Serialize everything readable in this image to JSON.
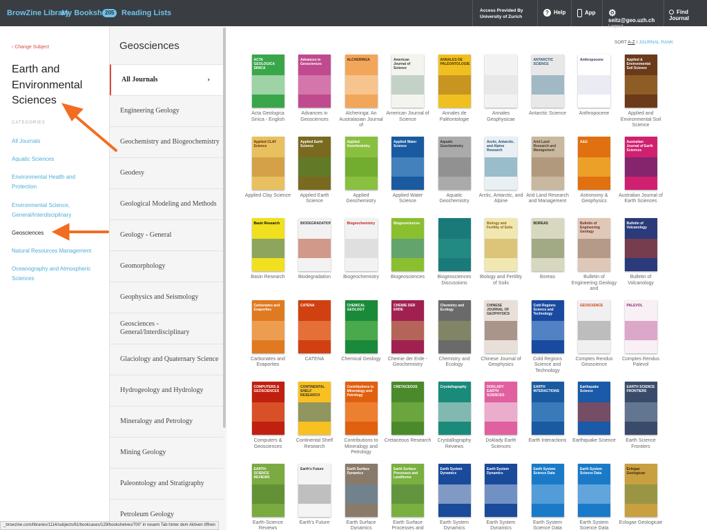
{
  "topbar": {
    "brand": "BrowZine Library",
    "bookshelf": "My Bookshelf",
    "bookshelf_count": "205",
    "reading_lists": "Reading Lists",
    "access_line1": "Access Provided By",
    "access_line2": "University of Zurich",
    "help": "Help",
    "app": "App",
    "user_email": "seitz@geo.uzh.ch",
    "logout": "Logout",
    "find_journal": "Find Journal"
  },
  "left": {
    "change_subject": "‹ Change Subject",
    "subject_title": "Earth and Environmental Sciences",
    "categories_label": "CATEGORIES",
    "categories": [
      {
        "label": "All Journals",
        "active": false
      },
      {
        "label": "Aquatic Sciences",
        "active": false
      },
      {
        "label": "Environmental Health and Protection",
        "active": false
      },
      {
        "label": "Environmental Science, General/Interdisciplinary",
        "active": false
      },
      {
        "label": "Geosciences",
        "active": true
      },
      {
        "label": "Natural Resources Management",
        "active": false
      },
      {
        "label": "Oceanography and Atmospheric Sciences",
        "active": false
      }
    ]
  },
  "subjects": {
    "title": "Geosciences",
    "items": [
      {
        "label": "All Journals",
        "active": true
      },
      {
        "label": "Engineering Geology",
        "active": false
      },
      {
        "label": "Geochemistry and Biogeochemistry",
        "active": false
      },
      {
        "label": "Geodesy",
        "active": false
      },
      {
        "label": "Geological Modeling and Methods",
        "active": false
      },
      {
        "label": "Geology - General",
        "active": false
      },
      {
        "label": "Geomorphology",
        "active": false
      },
      {
        "label": "Geophysics and Seismology",
        "active": false
      },
      {
        "label": "Geosciences - General/Interdisciplinary",
        "active": false
      },
      {
        "label": "Glaciology and Quaternary Science",
        "active": false
      },
      {
        "label": "Hydrogeology and Hydrology",
        "active": false
      },
      {
        "label": "Mineralogy and Petrology",
        "active": false
      },
      {
        "label": "Mining Geology",
        "active": false
      },
      {
        "label": "Paleontology and Stratigraphy",
        "active": false
      },
      {
        "label": "Petroleum Geology",
        "active": false
      }
    ]
  },
  "sort": {
    "label": "SORT",
    "az": "A-Z",
    "sep": " / ",
    "rank": "JOURNAL RANK"
  },
  "journals": [
    {
      "title": "Acta Geologica Sinica - English",
      "cover": "ACTA GEOLOGICA SINICA",
      "color": "#3aa64a",
      "text": "#ffffff",
      "accent": "#ffffff"
    },
    {
      "title": "Advances in Geosciences",
      "cover": "Advances in Geosciences",
      "color": "#c04a8e",
      "text": "#ffffff",
      "accent": "#e8a0c8"
    },
    {
      "title": "Alcheringa: An Australasian Journal of",
      "cover": "ALCHERINGA",
      "color": "#f2a65a",
      "text": "#4a2a10",
      "accent": "#fbe1c2"
    },
    {
      "title": "American Journal of Science",
      "cover": "American Journal of Science",
      "color": "#f4f4ef",
      "text": "#333333",
      "accent": "#8fb0a0"
    },
    {
      "title": "Annales de Paléontologie",
      "cover": "ANNALES DE PALÉONTOLOGIE",
      "color": "#f0c020",
      "text": "#4a3300",
      "accent": "#a06a20"
    },
    {
      "title": "Annales Geophysicae",
      "cover": "",
      "color": "#f2f2f2",
      "text": "#888888",
      "accent": "#dddddd"
    },
    {
      "title": "Antarctic Science",
      "cover": "ANTARCTIC SCIENCE",
      "color": "#e8e8e8",
      "text": "#2a5a7a",
      "accent": "#5a8aa0"
    },
    {
      "title": "Anthropocene",
      "cover": "Anthropocene",
      "color": "#ffffff",
      "text": "#333366",
      "accent": "#d8d8e8"
    },
    {
      "title": "Applied and Environmental Soil Science",
      "cover": "Applied & Environmental Soil Science",
      "color": "#6a3a1a",
      "text": "#ffffff",
      "accent": "#b08030"
    },
    {
      "title": "Applied Clay Science",
      "cover": "Applied CLAY Science",
      "color": "#e8c060",
      "text": "#6a3000",
      "accent": "#c08030"
    },
    {
      "title": "Applied Earth Science",
      "cover": "Applied Earth Science",
      "color": "#7a6a20",
      "text": "#ffffff",
      "accent": "#4a8a30"
    },
    {
      "title": "Applied Geochemistry",
      "cover": "Applied Geochemistry",
      "color": "#8ac040",
      "text": "#ffffff",
      "accent": "#5a9a20"
    },
    {
      "title": "Applied Water Science",
      "cover": "Applied Water Science",
      "color": "#1a5aa0",
      "text": "#ffffff",
      "accent": "#6aa8d8"
    },
    {
      "title": "Aquatic Geochemistry",
      "cover": "Aquatic Geochemistry",
      "color": "#aaaaaa",
      "text": "#333333",
      "accent": "#777777"
    },
    {
      "title": "Arctic, Antarctic, and Alpine",
      "cover": "Arctic, Antarctic, and Alpine Research",
      "color": "#e8f0f4",
      "text": "#2a4a6a",
      "accent": "#4a8aa0"
    },
    {
      "title": "Arid Land Research and Management",
      "cover": "Arid Land Research and Management",
      "color": "#c8b8a0",
      "text": "#4a3a2a",
      "accent": "#9a7a5a"
    },
    {
      "title": "Astronomy & Geophysics",
      "cover": "A&G",
      "color": "#e07010",
      "text": "#ffffff",
      "accent": "#f8d040"
    },
    {
      "title": "Australian Journal of Earth Sciences",
      "cover": "Australian Journal of Earth Sciences",
      "color": "#d02070",
      "text": "#ffffff",
      "accent": "#3a2a6a"
    },
    {
      "title": "Basin Research",
      "cover": "Basin Research",
      "color": "#f0e020",
      "text": "#000000",
      "accent": "#2a6a9a"
    },
    {
      "title": "Biodegradation",
      "cover": "BIODEGRADATION",
      "color": "#f2f2f2",
      "text": "#333333",
      "accent": "#b04020"
    },
    {
      "title": "Biogeochemistry",
      "cover": "Biogeochemistry",
      "color": "#f2f2f2",
      "text": "#c02020",
      "accent": "#cccccc"
    },
    {
      "title": "Biogeosciences",
      "cover": "Biogeosciences",
      "color": "#8abf30",
      "text": "#ffffff",
      "accent": "#3a8aa8"
    },
    {
      "title": "Biogeosciences Discussions",
      "cover": "",
      "color": "#1a7a7a",
      "text": "#ffffff",
      "accent": "#2a9a8a"
    },
    {
      "title": "Biology and Fertility of Soils",
      "cover": "Biology and Fertility of Soils",
      "color": "#f0e8b0",
      "text": "#8a5a10",
      "accent": "#c8a040"
    },
    {
      "title": "Boreas",
      "cover": "BOREAS",
      "color": "#d8d8c0",
      "text": "#222222",
      "accent": "#6a7a4a"
    },
    {
      "title": "Bulletin of Engineering Geology and",
      "cover": "Bulletin of Engineering Geology",
      "color": "#e0c8b8",
      "text": "#6a2a1a",
      "accent": "#8a6a5a"
    },
    {
      "title": "Bulletin of Volcanology",
      "cover": "Bulletin of Volcanology",
      "color": "#2a3a7a",
      "text": "#ffffff",
      "accent": "#c04020"
    },
    {
      "title": "Carbonates and Evaporites",
      "cover": "Carbonates and Evaporites",
      "color": "#e07a20",
      "text": "#ffffff",
      "accent": "#f8c080"
    },
    {
      "title": "CATENA",
      "cover": "CATENA",
      "color": "#d04010",
      "text": "#ffffff",
      "accent": "#f8a060"
    },
    {
      "title": "Chemical Geology",
      "cover": "CHEMICAL GEOLOGY",
      "color": "#1a8a3a",
      "text": "#ffffff",
      "accent": "#7ac860"
    },
    {
      "title": "Chemie der Erde - Geochemistry",
      "cover": "CHEMIE DER ERDE",
      "color": "#a02050",
      "text": "#ffffff",
      "accent": "#c8a860"
    },
    {
      "title": "Chemistry and Ecology",
      "cover": "Chemistry and Ecology",
      "color": "#6a6a6a",
      "text": "#ffffff",
      "accent": "#9aa060"
    },
    {
      "title": "Chinese Journal of Geophysics",
      "cover": "CHINESE JOURNAL OF GEOPHYSICS",
      "color": "#e8e0d8",
      "text": "#333333",
      "accent": "#6a4a3a"
    },
    {
      "title": "Cold Regions Science and Technology",
      "cover": "Cold Regions Science and Technology",
      "color": "#1a4aa0",
      "text": "#ffffff",
      "accent": "#8ab8e8"
    },
    {
      "title": "Comptes Rendus Geoscience",
      "cover": "GEOSCIENCE",
      "color": "#f0f0f0",
      "text": "#d04010",
      "accent": "#8a8a8a"
    },
    {
      "title": "Comptes Rendus Palevol",
      "cover": "PALEVOL",
      "color": "#f8f0f4",
      "text": "#8a2a6a",
      "accent": "#c060a0"
    },
    {
      "title": "Computers & Geosciences",
      "cover": "COMPUTERS & GEOSCIENCES",
      "color": "#c02010",
      "text": "#ffffff",
      "accent": "#f08040"
    },
    {
      "title": "Continental Shelf Research",
      "cover": "CONTINENTAL SHELF RESEARCH",
      "color": "#f8c020",
      "text": "#333333",
      "accent": "#2a6aa0"
    },
    {
      "title": "Contributions to Mineralogy and Petrology",
      "cover": "Contributions to Mineralogy and Petrology",
      "color": "#e06010",
      "text": "#ffffff",
      "accent": "#f8a050"
    },
    {
      "title": "Cretaceous Research",
      "cover": "CRETACEOUS",
      "color": "#4a8a2a",
      "text": "#ffffff",
      "accent": "#8ac050"
    },
    {
      "title": "Crystallography Reviews",
      "cover": "Crystallography",
      "color": "#1a8a7a",
      "text": "#ffffff",
      "accent": "#e8e8e8"
    },
    {
      "title": "Doklady Earth Sciences",
      "cover": "DOKLADY EARTH SCIENCES",
      "color": "#e060a0",
      "text": "#ffffff",
      "accent": "#f8f8f8"
    },
    {
      "title": "Earth Interactions",
      "cover": "EARTH INTERACTIONS",
      "color": "#1a5aa0",
      "text": "#ffffff",
      "accent": "#5a9ad0"
    },
    {
      "title": "Earthquake Science",
      "cover": "Earthquake Science",
      "color": "#1a5aa8",
      "text": "#ffffff",
      "accent": "#d04020"
    },
    {
      "title": "Earth Science Frontiers",
      "cover": "EARTH SCIENCE FRONTIERS",
      "color": "#3a4a6a",
      "text": "#ffffff",
      "accent": "#8aa0b8"
    },
    {
      "title": "Earth-Science Reviews",
      "cover": "EARTH-SCIENCE REVIEWS",
      "color": "#7aaa40",
      "text": "#ffffff",
      "accent": "#4a7a2a"
    },
    {
      "title": "Earth's Future",
      "cover": "Earth's Future",
      "color": "#f4f4f4",
      "text": "#333333",
      "accent": "#8a8a8a"
    },
    {
      "title": "Earth Surface Dynamics",
      "cover": "Earth Surface Dynamics",
      "color": "#8a7a6a",
      "text": "#ffffff",
      "accent": "#5a8ab0"
    },
    {
      "title": "Earth Surface Processes and",
      "cover": "Earth Surface Processes and Landforms",
      "color": "#7ab040",
      "text": "#ffffff",
      "accent": "#4a7a3a"
    },
    {
      "title": "Earth System Dynamics",
      "cover": "Earth System Dynamics",
      "color": "#1a4a9a",
      "text": "#ffffff",
      "accent": "#e8e8f0"
    },
    {
      "title": "Earth System Dynamics",
      "cover": "Earth System Dynamics",
      "color": "#1a4a9a",
      "text": "#ffffff",
      "accent": "#c8d8f0"
    },
    {
      "title": "Earth System Science Data",
      "cover": "Earth System Science Data",
      "color": "#1a7ac8",
      "text": "#ffffff",
      "accent": "#8ac0e8"
    },
    {
      "title": "Earth System Science Data",
      "cover": "Earth System Science Data",
      "color": "#1a7ac8",
      "text": "#ffffff",
      "accent": "#a8d0f0"
    },
    {
      "title": "Eclogae Geologicae",
      "cover": "Eclogae Geologicae",
      "color": "#c8a040",
      "text": "#3a2a0a",
      "accent": "#6a8a4a"
    }
  ],
  "status_url": "_browzine.com/libraries/1114/subjects/61/bookcases/129/bookshelves/700\" in neuem Tab hinter dem Aktiven öffnen"
}
